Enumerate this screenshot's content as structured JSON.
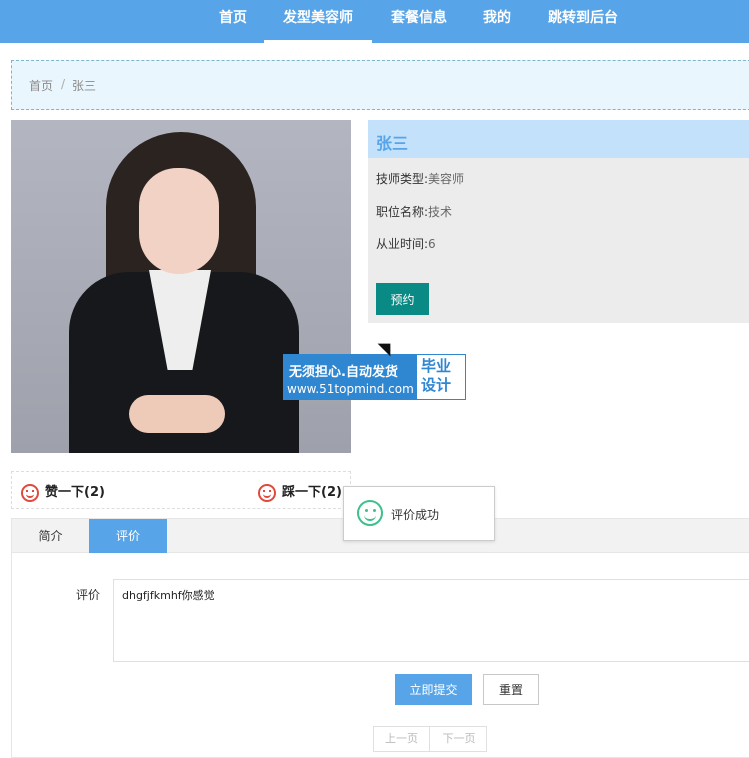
{
  "nav": {
    "items": [
      "首页",
      "发型美容师",
      "套餐信息",
      "我的",
      "跳转到后台"
    ],
    "active_index": 1
  },
  "breadcrumb": {
    "home": "首页",
    "separator": "/",
    "current": "张三"
  },
  "photo_watermark": {
    "line1": "无须担心.自动发货",
    "line2": "www.51topmind.com",
    "right": "毕业设计"
  },
  "profile": {
    "name": "张三",
    "type_label": "技师类型:",
    "type_value": "美容师",
    "position_label": "职位名称:",
    "position_value": "技术",
    "years_label": "从业时间:",
    "years_value": "6",
    "reserve_button": "预约"
  },
  "votes": {
    "like_label": "赞一下(2)",
    "dislike_label": "踩一下(2)"
  },
  "toast": {
    "message": "评价成功"
  },
  "tabs": {
    "items": [
      "简介",
      "评价"
    ],
    "active_index": 1
  },
  "review_form": {
    "label": "评价",
    "value": "dhgfjfkmhf你感觉",
    "submit_button": "立即提交",
    "reset_button": "重置"
  },
  "pager": {
    "prev": "上一页",
    "next": "下一页"
  },
  "colors": {
    "primary": "#57a5e8",
    "reserve_button": "#098a84",
    "breadcrumb_bg": "#eaf6fd",
    "success_icon": "#3ec08d",
    "vote_icon": "#e04a3c"
  }
}
